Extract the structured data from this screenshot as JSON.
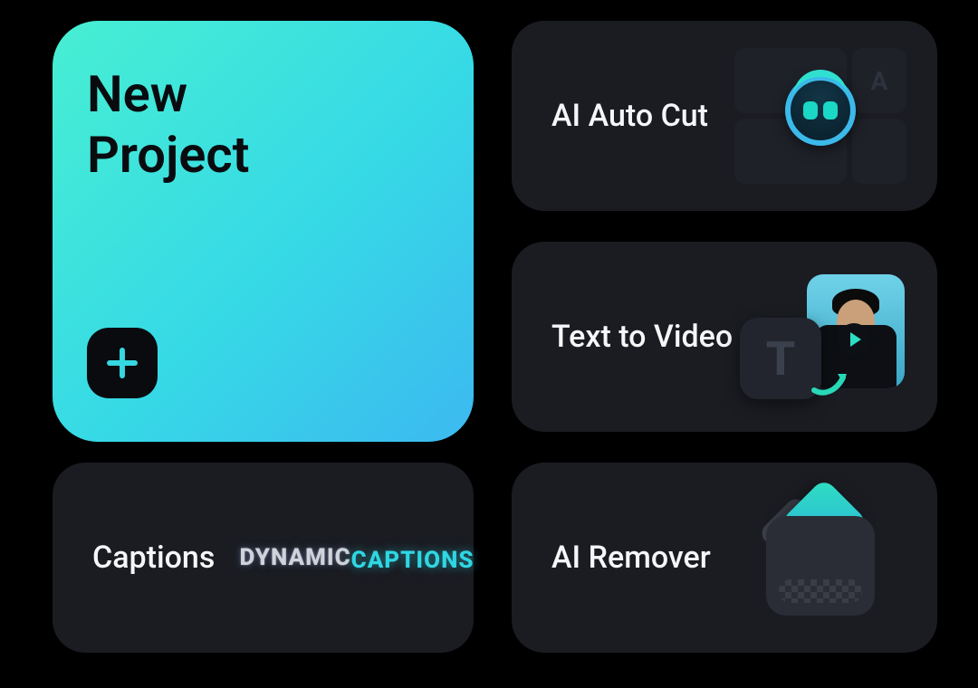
{
  "new_project": {
    "title_line1": "New",
    "title_line2": "Project"
  },
  "tiles": {
    "ai_auto_cut": {
      "label": "AI Auto Cut",
      "badge_letter": "A"
    },
    "text_to_video": {
      "label": "Text to Video",
      "letter": "T"
    },
    "captions": {
      "label": "Captions",
      "art_line1": "DYNAMIC",
      "art_line2": "CAPTIONS"
    },
    "ai_remover": {
      "label": "AI Remover"
    }
  },
  "colors": {
    "accent_start": "#47efd2",
    "accent_end": "#3cb9f0",
    "tile_bg": "#1a1c22"
  }
}
